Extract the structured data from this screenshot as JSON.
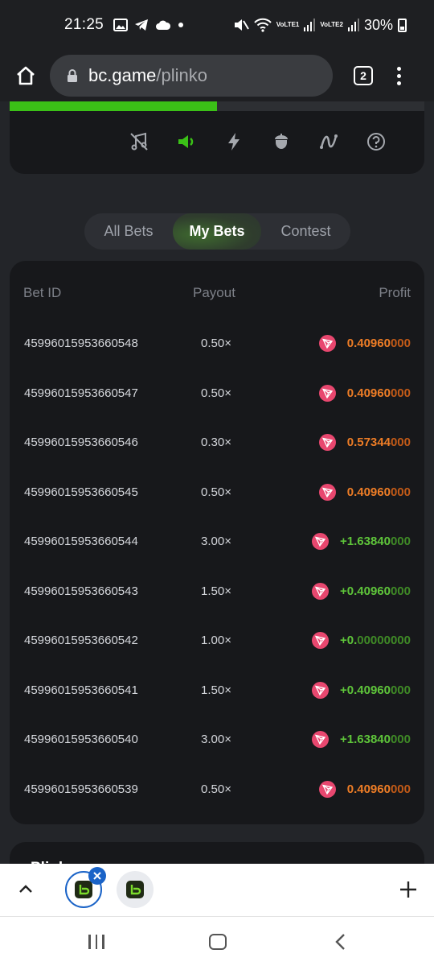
{
  "status_bar": {
    "time": "21:25",
    "sim1": "VoLTE1",
    "sim2": "VoLTE2",
    "battery": "30%"
  },
  "browser": {
    "url_host": "bc.game",
    "url_path": "/plinko",
    "tab_count": "2"
  },
  "game": {
    "progress_fraction": 0.5,
    "accent_color": "#3bc117",
    "controls": [
      "music-off-icon",
      "sound-icon",
      "fast-mode-icon",
      "fairness-icon",
      "trend-icon",
      "help-icon"
    ]
  },
  "bet_tabs": {
    "all": "All Bets",
    "mine": "My Bets",
    "contest": "Contest",
    "selected": "My Bets"
  },
  "table": {
    "headers": {
      "bet_id": "Bet ID",
      "payout": "Payout",
      "profit": "Profit"
    },
    "rows": [
      {
        "id": "45996015953660548",
        "payout": "0.50×",
        "profit_main": "0.40960",
        "profit_tail": "000",
        "positive": false
      },
      {
        "id": "45996015953660547",
        "payout": "0.50×",
        "profit_main": "0.40960",
        "profit_tail": "000",
        "positive": false
      },
      {
        "id": "45996015953660546",
        "payout": "0.30×",
        "profit_main": "0.57344",
        "profit_tail": "000",
        "positive": false
      },
      {
        "id": "45996015953660545",
        "payout": "0.50×",
        "profit_main": "0.40960",
        "profit_tail": "000",
        "positive": false
      },
      {
        "id": "45996015953660544",
        "payout": "3.00×",
        "profit_main": "+1.63840",
        "profit_tail": "000",
        "positive": true
      },
      {
        "id": "45996015953660543",
        "payout": "1.50×",
        "profit_main": "+0.40960",
        "profit_tail": "000",
        "positive": true
      },
      {
        "id": "45996015953660542",
        "payout": "1.00×",
        "profit_main": "+0.",
        "profit_tail": "00000000",
        "positive": true
      },
      {
        "id": "45996015953660541",
        "payout": "1.50×",
        "profit_main": "+0.40960",
        "profit_tail": "000",
        "positive": true
      },
      {
        "id": "45996015953660540",
        "payout": "3.00×",
        "profit_main": "+1.63840",
        "profit_tail": "000",
        "positive": true
      },
      {
        "id": "45996015953660539",
        "payout": "0.50×",
        "profit_main": "0.40960",
        "profit_tail": "000",
        "positive": false
      }
    ]
  },
  "peek_card": {
    "title": "Plinko"
  },
  "colors": {
    "loss": "#ee7d26",
    "win": "#5ec43a",
    "coin": "#e8476f"
  }
}
